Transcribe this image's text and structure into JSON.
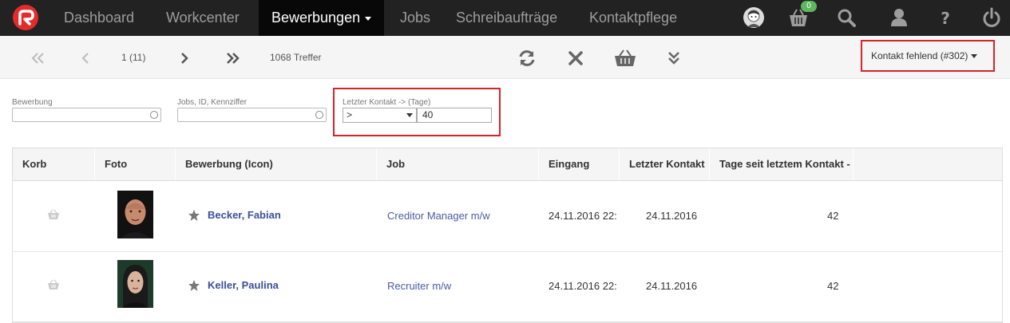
{
  "nav": {
    "items": [
      "Dashboard",
      "Workcenter",
      "Bewerbungen",
      "Jobs",
      "Schreibaufträge",
      "Kontaktpflege"
    ],
    "basket_count": "0"
  },
  "toolbar": {
    "page_indicator": "1 (11)",
    "hits": "1068 Treffer",
    "filter_preset": "Kontakt fehlend (#302)"
  },
  "filters": {
    "bewerbung_label": "Bewerbung",
    "bewerbung_value": "",
    "jobs_label": "Jobs, ID, Kennziffer",
    "jobs_value": "",
    "kontakt_label": "Letzter Kontakt -> (Tage)",
    "kontakt_operator": ">",
    "kontakt_value": "40"
  },
  "table": {
    "headers": [
      "Korb",
      "Foto",
      "Bewerbung (Icon)",
      "Job",
      "Eingang",
      "Letzter Kontakt",
      "Tage seit letztem Kontakt -"
    ],
    "rows": [
      {
        "name": "Becker, Fabian",
        "job": "Creditor Manager m/w",
        "eingang": "24.11.2016 22:",
        "letzter_kontakt": "24.11.2016",
        "tage": "42"
      },
      {
        "name": "Keller, Paulina",
        "job": "Recruiter m/w",
        "eingang": "24.11.2016 22:",
        "letzter_kontakt": "24.11.2016",
        "tage": "42"
      }
    ]
  },
  "colors": {
    "accent_red": "#d9232a",
    "link_blue": "#4b5aa4",
    "navbar": "#222222",
    "badge_green": "#5cb85c"
  },
  "icons": [
    "logo-icon",
    "avatar-icon",
    "basket-icon",
    "search-icon",
    "user-icon",
    "help-icon",
    "power-icon",
    "first-page-icon",
    "prev-page-icon",
    "next-page-icon",
    "last-page-icon",
    "refresh-icon",
    "clear-icon",
    "basket-icon",
    "expand-icon",
    "star-icon"
  ]
}
